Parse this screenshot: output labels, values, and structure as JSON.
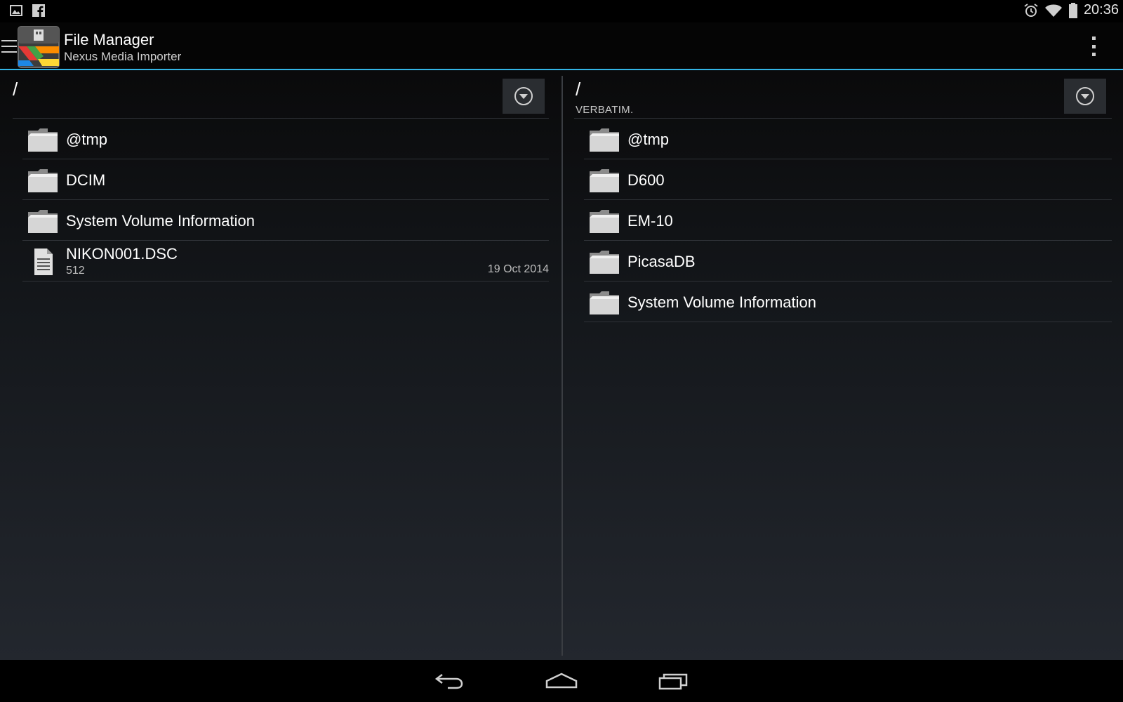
{
  "status_bar": {
    "time": "20:36",
    "left_icons": [
      "image-notification-icon",
      "facebook-notification-icon"
    ],
    "right_icons": [
      "alarm-icon",
      "wifi-icon",
      "battery-icon"
    ]
  },
  "action_bar": {
    "title": "File Manager",
    "subtitle": "Nexus Media Importer",
    "accent_color": "#33b5e5"
  },
  "left_pane": {
    "path": "/",
    "items": [
      {
        "type": "folder",
        "name": "@tmp"
      },
      {
        "type": "folder",
        "name": "DCIM"
      },
      {
        "type": "folder",
        "name": "System Volume Information"
      },
      {
        "type": "file",
        "name": "NIKON001.DSC",
        "size": "512",
        "date": "19 Oct 2014"
      }
    ]
  },
  "right_pane": {
    "path": "/",
    "volume": "VERBATIM.",
    "items": [
      {
        "type": "folder",
        "name": "@tmp"
      },
      {
        "type": "folder",
        "name": "D600"
      },
      {
        "type": "folder",
        "name": "EM-10"
      },
      {
        "type": "folder",
        "name": "PicasaDB"
      },
      {
        "type": "folder",
        "name": "System Volume Information"
      }
    ]
  },
  "nav_bar": {
    "buttons": [
      "back-icon",
      "home-icon",
      "recents-icon"
    ]
  }
}
